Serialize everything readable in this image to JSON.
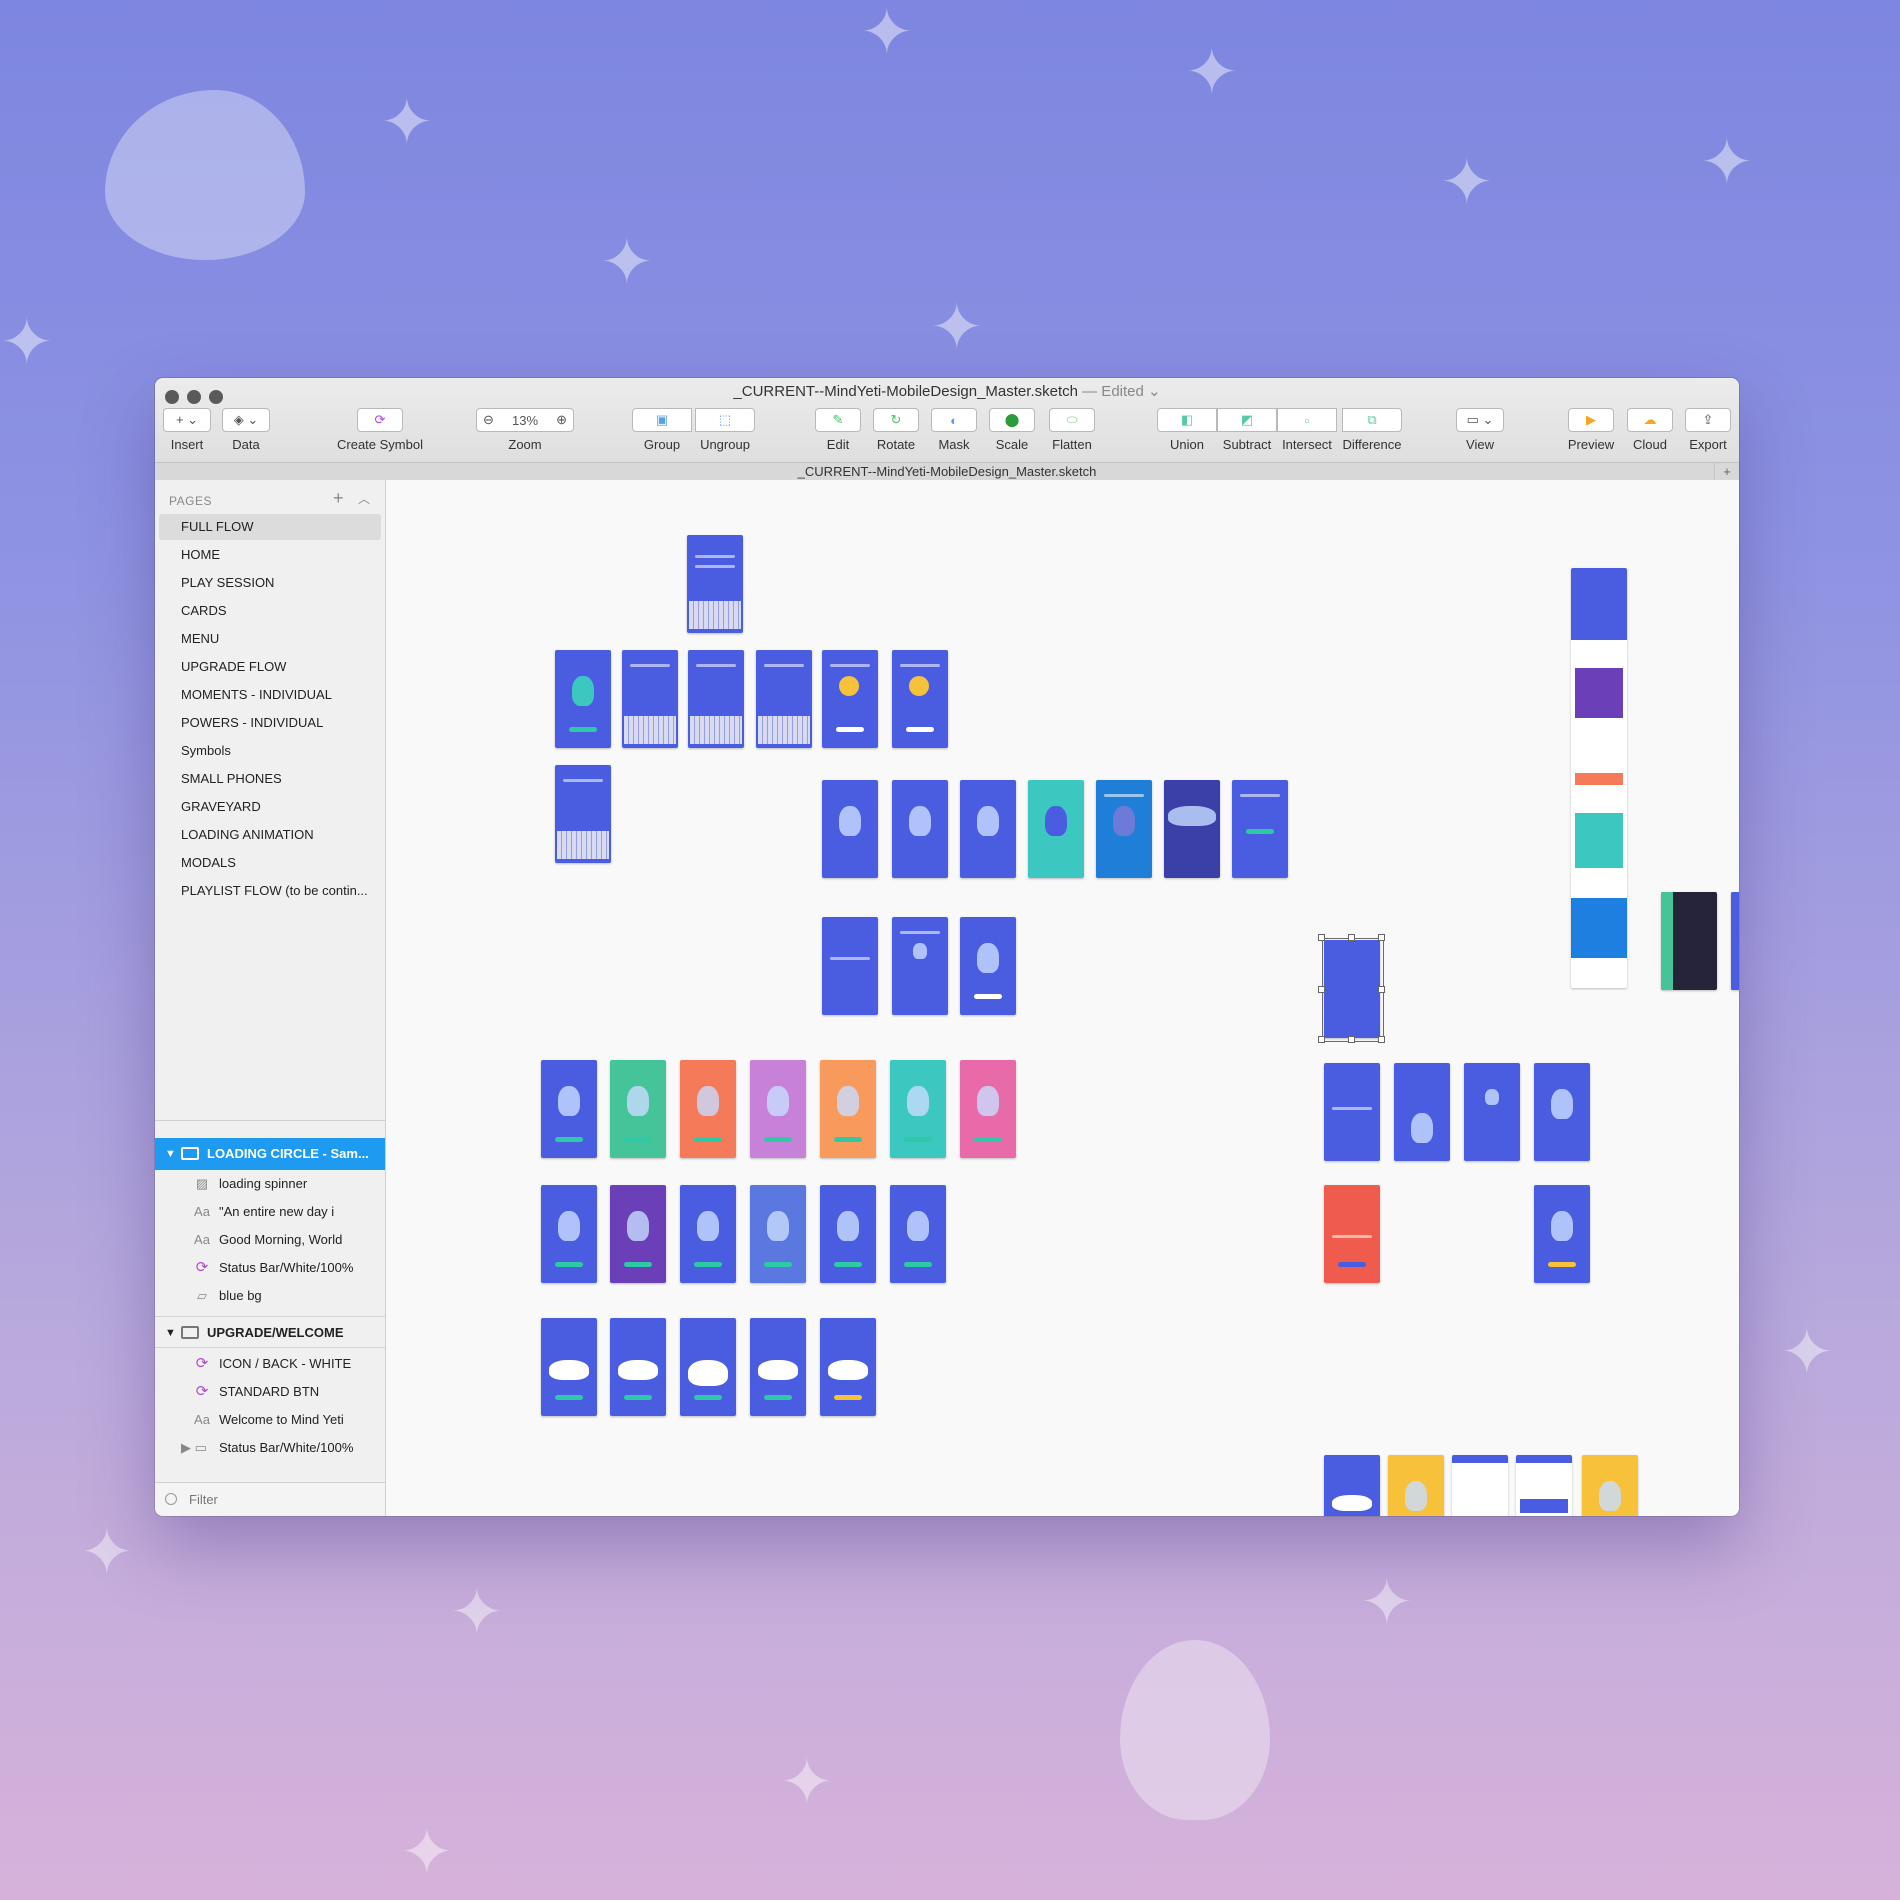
{
  "window": {
    "document_title": "_CURRENT--MindYeti-MobileDesign_Master.sketch",
    "edited_label": "— Edited",
    "tab_title": "_CURRENT--MindYeti-MobileDesign_Master.sketch"
  },
  "toolbar": {
    "insert": "Insert",
    "data": "Data",
    "create_symbol": "Create Symbol",
    "zoom_label": "Zoom",
    "zoom_value": "13%",
    "group": "Group",
    "ungroup": "Ungroup",
    "edit": "Edit",
    "rotate": "Rotate",
    "mask": "Mask",
    "scale": "Scale",
    "flatten": "Flatten",
    "union": "Union",
    "subtract": "Subtract",
    "intersect": "Intersect",
    "difference": "Difference",
    "view": "View",
    "preview": "Preview",
    "cloud": "Cloud",
    "export": "Export"
  },
  "sidebar": {
    "pages_header": "PAGES",
    "pages": [
      "FULL FLOW",
      "HOME",
      "PLAY SESSION",
      "CARDS",
      "MENU",
      "UPGRADE FLOW",
      "MOMENTS - INDIVIDUAL",
      "POWERS - INDIVIDUAL",
      "Symbols",
      "SMALL PHONES",
      "GRAVEYARD",
      "LOADING ANIMATION",
      "MODALS",
      "PLAYLIST FLOW (to be contin..."
    ],
    "layers": {
      "group1": {
        "label": "LOADING CIRCLE - Sam...",
        "items": [
          "loading spinner",
          "\"An entire new day i",
          "Good Morning, World",
          "Status Bar/White/100%",
          "blue bg"
        ]
      },
      "group2": {
        "label": "UPGRADE/WELCOME",
        "items": [
          "ICON / BACK - WHITE",
          "STANDARD BTN",
          "Welcome to Mind Yeti",
          "Status Bar/White/100%"
        ]
      }
    },
    "filter_placeholder": "Filter"
  },
  "colors": {
    "accent_selection": "#1e9bf0",
    "artboard_blue": "#4a5de0",
    "artboard_green": "#45c49a",
    "artboard_orange": "#f47a5a",
    "artboard_pink": "#e86aa8",
    "artboard_purple": "#6a3fb8",
    "artboard_yellow": "#f7c23a",
    "artboard_red": "#ef5b4c",
    "artboard_teal": "#3cc8c0",
    "artboard_dark": "#262438"
  }
}
